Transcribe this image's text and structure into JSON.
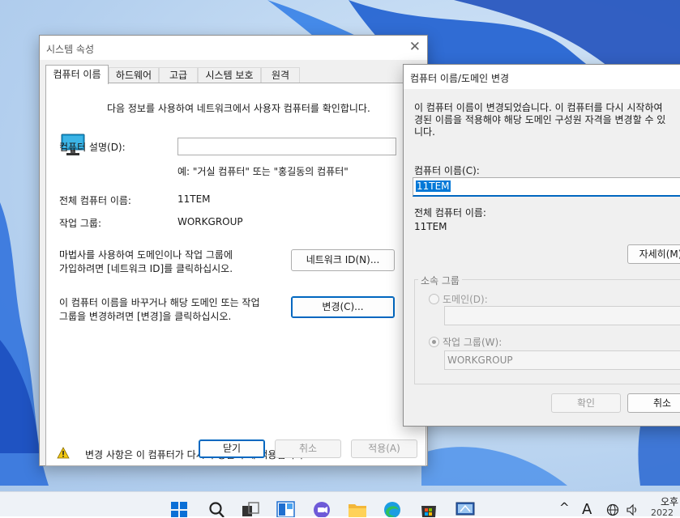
{
  "colors": {
    "accent": "#0067c0",
    "selection": "#0078d7",
    "warning": "#f2c811",
    "disabled_text": "#9a9a9a"
  },
  "system_properties": {
    "title": "시스템 속성",
    "tabs": [
      "컴퓨터 이름",
      "하드웨어",
      "고급",
      "시스템 보호",
      "원격"
    ],
    "active_tab": "컴퓨터 이름",
    "intro": "다음 정보를 사용하여 네트워크에서 사용자 컴퓨터를 확인합니다.",
    "description_label": "컴퓨터 설명(D):",
    "description_value": "",
    "example": "예: \"거실 컴퓨터\" 또는 \"홍길동의 컴퓨터\"",
    "full_name_label": "전체 컴퓨터 이름:",
    "full_name_value": "11TEM",
    "workgroup_label": "작업 그룹:",
    "workgroup_value": "WORKGROUP",
    "network_id_line1": "마법사를 사용하여 도메인이나 작업 그룹에",
    "network_id_line2": "가입하려면 [네트워크 ID]를 클릭하십시오.",
    "network_id_button": "네트워크 ID(N)...",
    "change_line1": "이 컴퓨터 이름을 바꾸거나 해당 도메인 또는 작업",
    "change_line2": "그룹을 변경하려면 [변경]을 클릭하십시오.",
    "change_button": "변경(C)...",
    "warning_text": "변경 사항은 이 컴퓨터가 다시 부팅된 후에 적용됩니다.",
    "buttons": {
      "close": "닫기",
      "cancel": "취소",
      "apply": "적용(A)"
    }
  },
  "rename_dialog": {
    "title": "컴퓨터 이름/도메인 변경",
    "info_line1": "이 컴퓨터 이름이 변경되었습니다. 이 컴퓨터를 다시 시작하여",
    "info_line2": "경된 이름을 적용해야 해당 도메인 구성원 자격을 변경할 수 있",
    "info_line3": "니다.",
    "name_label": "컴퓨터 이름(C):",
    "name_value": "11TEM",
    "full_name_label": "전체 컴퓨터 이름:",
    "full_name_value": "11TEM",
    "more_button": "자세히(M)",
    "member_of": "소속 그룹",
    "domain_label": "도메인(D):",
    "domain_value": "",
    "workgroup_label": "작업 그룹(W):",
    "workgroup_value": "WORKGROUP",
    "selected_option": "workgroup",
    "ok": "확인",
    "cancel": "취소"
  },
  "taskbar": {
    "icons": [
      "start-icon",
      "search-icon",
      "task-view-icon",
      "widgets-icon",
      "chat-icon",
      "file-explorer-icon",
      "edge-icon",
      "store-icon",
      "system-properties-app-icon"
    ],
    "tray_chevron": "^",
    "ime": "A",
    "clock_top": "오후",
    "clock_bottom": "2022"
  }
}
